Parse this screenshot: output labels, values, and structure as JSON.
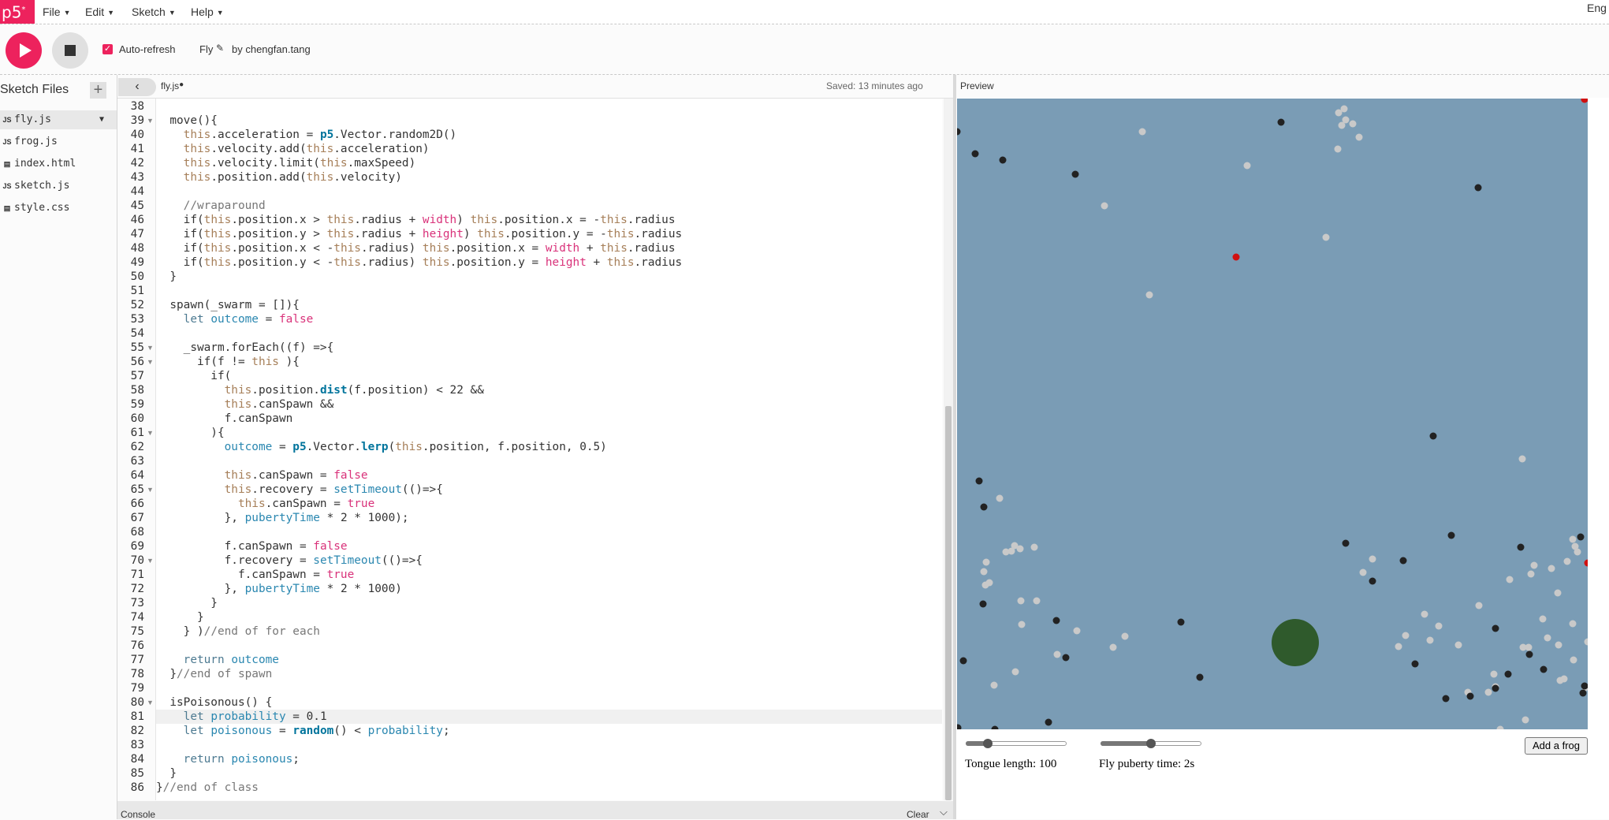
{
  "menubar": {
    "logo": "p5",
    "items": [
      "File",
      "Edit",
      "Sketch",
      "Help"
    ],
    "language": "Eng"
  },
  "toolbar": {
    "autorefresh_label": "Auto-refresh",
    "autorefresh_checked": true,
    "sketch_name": "Fly",
    "author": "by chengfan.tang"
  },
  "sidebar": {
    "title": "Sketch Files",
    "files": [
      {
        "type": "JS",
        "name": "fly.js",
        "active": true
      },
      {
        "type": "JS",
        "name": "frog.js"
      },
      {
        "type": "doc",
        "name": "index.html"
      },
      {
        "type": "JS",
        "name": "sketch.js"
      },
      {
        "type": "doc",
        "name": "style.css"
      }
    ]
  },
  "editor": {
    "tab": "fly.js",
    "saved_status": "Saved: 13 minutes ago",
    "lines": [
      {
        "n": 38,
        "text": ""
      },
      {
        "n": 39,
        "text": "  move(){",
        "fold": true
      },
      {
        "n": 40,
        "text": "    this.acceleration = p5.Vector.random2D()"
      },
      {
        "n": 41,
        "text": "    this.velocity.add(this.acceleration)"
      },
      {
        "n": 42,
        "text": "    this.velocity.limit(this.maxSpeed)"
      },
      {
        "n": 43,
        "text": "    this.position.add(this.velocity)"
      },
      {
        "n": 44,
        "text": ""
      },
      {
        "n": 45,
        "text": "    //wraparound"
      },
      {
        "n": 46,
        "text": "    if(this.position.x > this.radius + width) this.position.x = -this.radius"
      },
      {
        "n": 47,
        "text": "    if(this.position.y > this.radius + height) this.position.y = -this.radius"
      },
      {
        "n": 48,
        "text": "    if(this.position.x < -this.radius) this.position.x = width + this.radius"
      },
      {
        "n": 49,
        "text": "    if(this.position.y < -this.radius) this.position.y = height + this.radius"
      },
      {
        "n": 50,
        "text": "  }"
      },
      {
        "n": 51,
        "text": ""
      },
      {
        "n": 52,
        "text": "  spawn(_swarm = []){"
      },
      {
        "n": 53,
        "text": "    let outcome = false"
      },
      {
        "n": 54,
        "text": ""
      },
      {
        "n": 55,
        "text": "    _swarm.forEach((f) =>{",
        "fold": true
      },
      {
        "n": 56,
        "text": "      if(f != this ){",
        "fold": true
      },
      {
        "n": 57,
        "text": "        if("
      },
      {
        "n": 58,
        "text": "          this.position.dist(f.position) < 22 &&"
      },
      {
        "n": 59,
        "text": "          this.canSpawn &&"
      },
      {
        "n": 60,
        "text": "          f.canSpawn"
      },
      {
        "n": 61,
        "text": "        ){",
        "fold": true
      },
      {
        "n": 62,
        "text": "          outcome = p5.Vector.lerp(this.position, f.position, 0.5)"
      },
      {
        "n": 63,
        "text": ""
      },
      {
        "n": 64,
        "text": "          this.canSpawn = false"
      },
      {
        "n": 65,
        "text": "          this.recovery = setTimeout(()=>{",
        "fold": true
      },
      {
        "n": 66,
        "text": "            this.canSpawn = true"
      },
      {
        "n": 67,
        "text": "          }, pubertyTime * 2 * 1000);"
      },
      {
        "n": 68,
        "text": ""
      },
      {
        "n": 69,
        "text": "          f.canSpawn = false"
      },
      {
        "n": 70,
        "text": "          f.recovery = setTimeout(()=>{",
        "fold": true
      },
      {
        "n": 71,
        "text": "            f.canSpawn = true"
      },
      {
        "n": 72,
        "text": "          }, pubertyTime * 2 * 1000)"
      },
      {
        "n": 73,
        "text": "        }"
      },
      {
        "n": 74,
        "text": "      }"
      },
      {
        "n": 75,
        "text": "    } )//end of for each"
      },
      {
        "n": 76,
        "text": ""
      },
      {
        "n": 77,
        "text": "    return outcome"
      },
      {
        "n": 78,
        "text": "  }//end of spawn"
      },
      {
        "n": 79,
        "text": ""
      },
      {
        "n": 80,
        "text": "  isPoisonous() {",
        "fold": true
      },
      {
        "n": 81,
        "text": "    let probability = 0.1",
        "highlight": true
      },
      {
        "n": 82,
        "text": "    let poisonous = random() < probability;"
      },
      {
        "n": 83,
        "text": ""
      },
      {
        "n": 84,
        "text": "    return poisonous;"
      },
      {
        "n": 85,
        "text": "  }"
      },
      {
        "n": 86,
        "text": "}//end of class"
      }
    ]
  },
  "console": {
    "label": "Console",
    "clear_label": "Clear"
  },
  "preview": {
    "label": "Preview",
    "background_color": "#7a9cb5",
    "tongue_label": "Tongue length: 100",
    "tongue_value": 100,
    "tongue_slider_fraction": 0.22,
    "puberty_label": "Fly puberty time: 2s",
    "puberty_slider_fraction": 0.5,
    "add_frog_label": "Add a frog"
  },
  "colors": {
    "accent": "#ed225d",
    "frog": "#2f5a2c",
    "fly_dark": "#222222",
    "fly_light": "#c9c9c9",
    "fly_poison": "#d01010"
  }
}
